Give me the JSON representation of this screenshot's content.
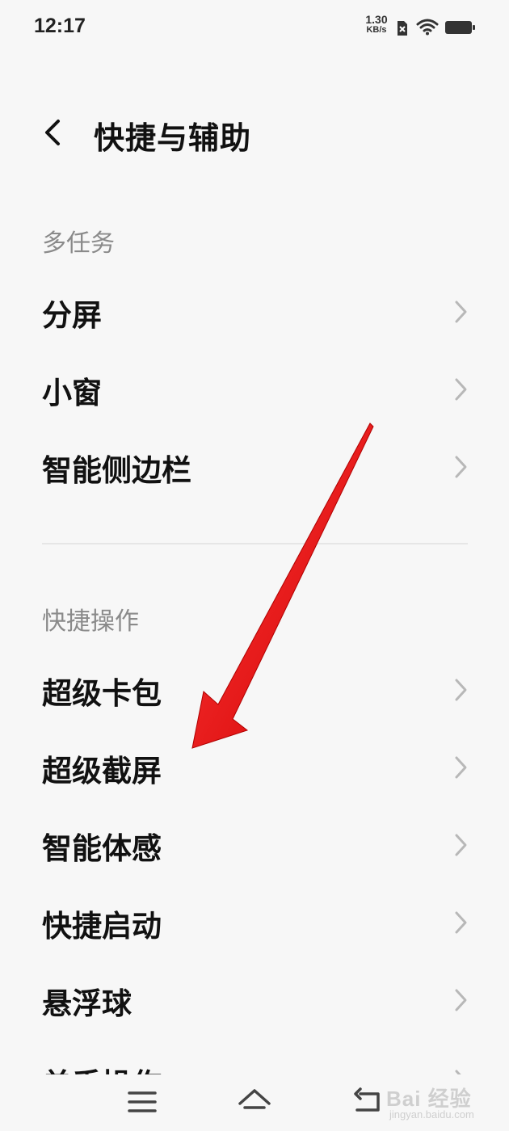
{
  "status_bar": {
    "time": "12:17",
    "net_speed_value": "1.30",
    "net_speed_unit": "KB/s",
    "icons": [
      "sim-blocked-icon",
      "wifi-icon",
      "battery-icon"
    ]
  },
  "header": {
    "title": "快捷与辅助",
    "back_icon": "chevron-left-icon"
  },
  "sections": [
    {
      "title": "多任务",
      "items": [
        {
          "label": "分屏"
        },
        {
          "label": "小窗"
        },
        {
          "label": "智能侧边栏"
        }
      ]
    },
    {
      "title": "快捷操作",
      "items": [
        {
          "label": "超级卡包"
        },
        {
          "label": "超级截屏"
        },
        {
          "label": "智能体感"
        },
        {
          "label": "快捷启动"
        },
        {
          "label": "悬浮球"
        },
        {
          "label": "单手操作"
        }
      ]
    }
  ],
  "nav_bar": {
    "icons": [
      "menu-icon",
      "home-icon",
      "back-icon"
    ]
  },
  "watermark": {
    "main": "Bai 经验",
    "sub": "jingyan.baidu.com"
  },
  "colors": {
    "background": "#f7f7f7",
    "text_primary": "#111111",
    "text_section": "#8a8a8a",
    "chevron": "#b8b8b8",
    "annotation_arrow": "#e60000"
  }
}
